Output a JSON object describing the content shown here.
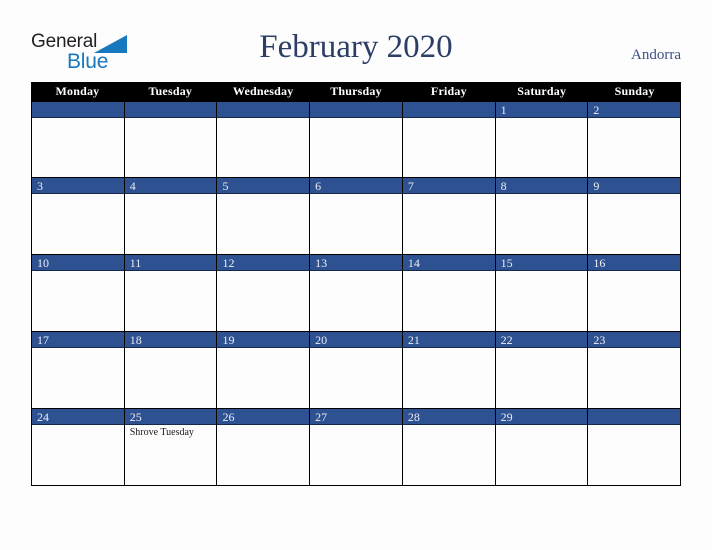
{
  "branding": {
    "logo_text_primary": "General",
    "logo_text_secondary": "Blue",
    "logo_primary_color": "#231f20",
    "logo_accent_color": "#1878be"
  },
  "header": {
    "title": "February 2020",
    "country": "Andorra",
    "title_color": "#2d3e66",
    "country_color": "#3d5283"
  },
  "calendar": {
    "month": "February",
    "year": "2020",
    "accent_color": "#2d5191",
    "header_bg_color": "#000000",
    "weekdays": [
      "Monday",
      "Tuesday",
      "Wednesday",
      "Thursday",
      "Friday",
      "Saturday",
      "Sunday"
    ],
    "weeks": [
      [
        {
          "day": "",
          "events": []
        },
        {
          "day": "",
          "events": []
        },
        {
          "day": "",
          "events": []
        },
        {
          "day": "",
          "events": []
        },
        {
          "day": "",
          "events": []
        },
        {
          "day": "1",
          "events": []
        },
        {
          "day": "2",
          "events": []
        }
      ],
      [
        {
          "day": "3",
          "events": []
        },
        {
          "day": "4",
          "events": []
        },
        {
          "day": "5",
          "events": []
        },
        {
          "day": "6",
          "events": []
        },
        {
          "day": "7",
          "events": []
        },
        {
          "day": "8",
          "events": []
        },
        {
          "day": "9",
          "events": []
        }
      ],
      [
        {
          "day": "10",
          "events": []
        },
        {
          "day": "11",
          "events": []
        },
        {
          "day": "12",
          "events": []
        },
        {
          "day": "13",
          "events": []
        },
        {
          "day": "14",
          "events": []
        },
        {
          "day": "15",
          "events": []
        },
        {
          "day": "16",
          "events": []
        }
      ],
      [
        {
          "day": "17",
          "events": []
        },
        {
          "day": "18",
          "events": []
        },
        {
          "day": "19",
          "events": []
        },
        {
          "day": "20",
          "events": []
        },
        {
          "day": "21",
          "events": []
        },
        {
          "day": "22",
          "events": []
        },
        {
          "day": "23",
          "events": []
        }
      ],
      [
        {
          "day": "24",
          "events": []
        },
        {
          "day": "25",
          "events": [
            "Shrove Tuesday"
          ]
        },
        {
          "day": "26",
          "events": []
        },
        {
          "day": "27",
          "events": []
        },
        {
          "day": "28",
          "events": []
        },
        {
          "day": "29",
          "events": []
        },
        {
          "day": "",
          "events": []
        }
      ]
    ]
  }
}
